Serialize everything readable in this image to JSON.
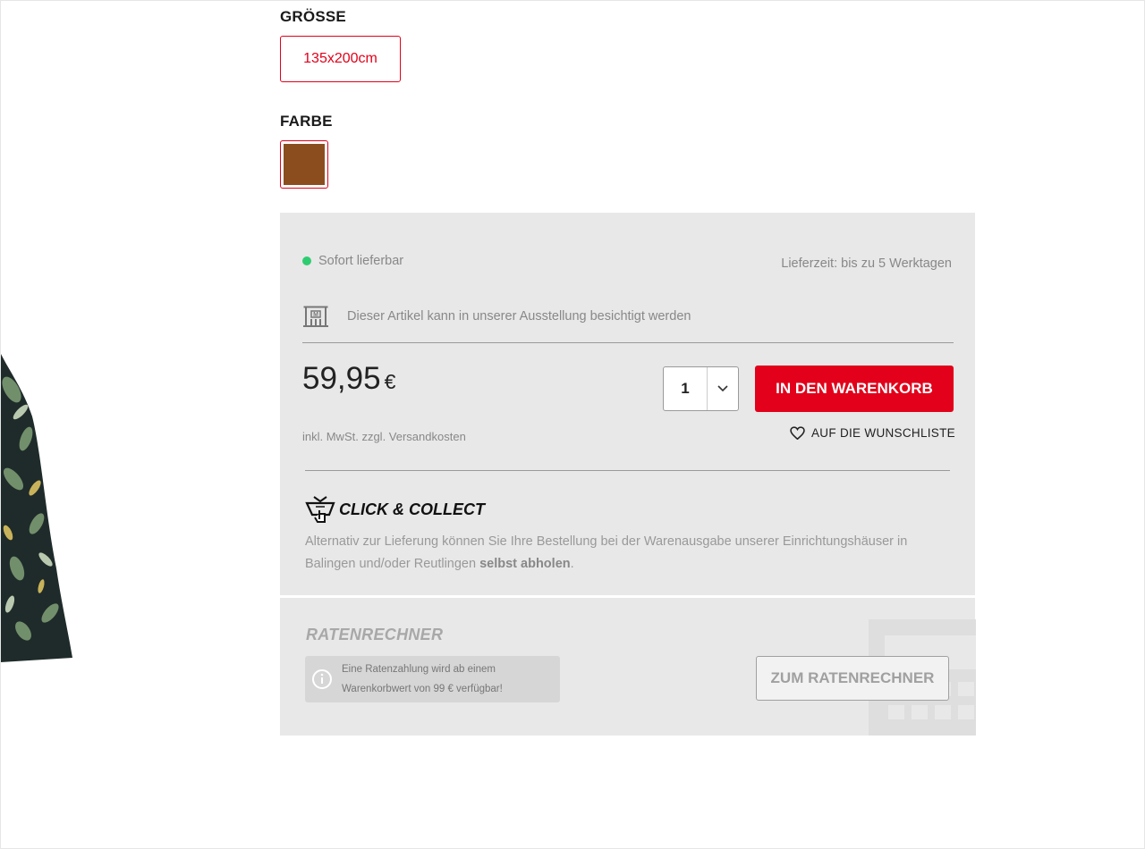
{
  "size": {
    "label": "GRÖSSE",
    "selected": "135x200cm"
  },
  "color": {
    "label": "FARBE",
    "swatch_hex": "#8b4d1e"
  },
  "availability": {
    "status": "Sofort lieferbar",
    "status_color": "#2ecc71",
    "delivery_time": "Lieferzeit: bis zu 5 Werktagen"
  },
  "showroom": {
    "text": "Dieser Artikel kann in unserer Ausstellung besichtigt werden",
    "icon": "showroom-icon"
  },
  "price": {
    "amount": "59,95",
    "currency": "€",
    "tax_note": "inkl. MwSt. zzgl. Versandkosten"
  },
  "cart": {
    "quantity": "1",
    "add_label": "IN DEN WARENKORB",
    "accent": "#e2001a"
  },
  "wishlist": {
    "label": "AUF DIE WUNSCHLISTE",
    "icon": "heart-icon"
  },
  "click_collect": {
    "title": "CLICK & COLLECT",
    "text_before": "Alternativ zur Lieferung können Sie Ihre Bestellung bei der Warenausgabe unserer Einrichtungshäuser in Balingen und/oder Reutlingen ",
    "text_bold": "selbst abholen",
    "text_after": "."
  },
  "rate_calculator": {
    "title": "RATENRECHNER",
    "info_line1": "Eine Ratenzahlung wird ab einem",
    "info_line2": "Warenkorbwert von 99 € verfügbar!",
    "button_label": "ZUM RATENRECHNER"
  }
}
